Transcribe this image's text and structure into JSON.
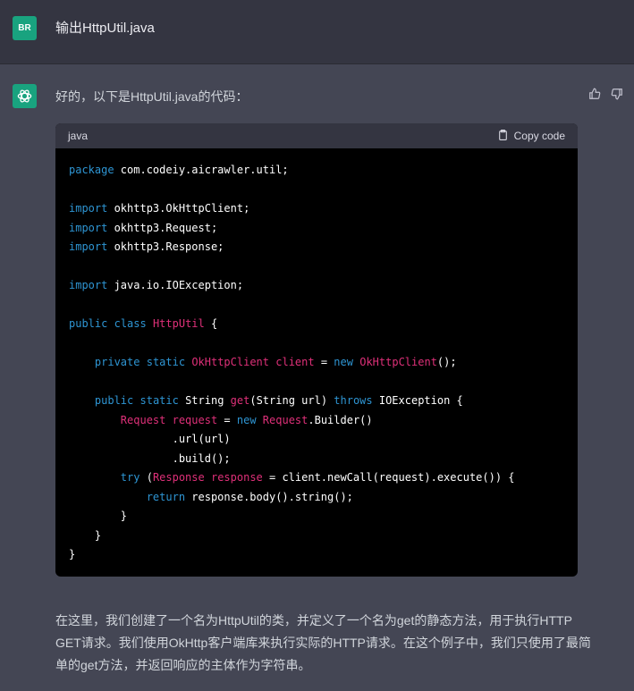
{
  "user": {
    "avatar_initials": "BR",
    "message": "输出HttpUtil.java"
  },
  "assistant": {
    "intro": "好的，以下是HttpUtil.java的代码：",
    "code_block": {
      "language": "java",
      "copy_label": "Copy code",
      "lines": [
        [
          {
            "t": "package",
            "c": "kw"
          },
          {
            "t": " com.codeiy.aicrawler.util;",
            "c": "pl"
          }
        ],
        [],
        [
          {
            "t": "import",
            "c": "kw"
          },
          {
            "t": " okhttp3.OkHttpClient;",
            "c": "pl"
          }
        ],
        [
          {
            "t": "import",
            "c": "kw"
          },
          {
            "t": " okhttp3.Request;",
            "c": "pl"
          }
        ],
        [
          {
            "t": "import",
            "c": "kw"
          },
          {
            "t": " okhttp3.Response;",
            "c": "pl"
          }
        ],
        [],
        [
          {
            "t": "import",
            "c": "kw"
          },
          {
            "t": " java.io.IOException;",
            "c": "pl"
          }
        ],
        [],
        [
          {
            "t": "public",
            "c": "kw"
          },
          {
            "t": " ",
            "c": "pl"
          },
          {
            "t": "class",
            "c": "kw"
          },
          {
            "t": " ",
            "c": "pl"
          },
          {
            "t": "HttpUtil",
            "c": "ty"
          },
          {
            "t": " {",
            "c": "pl"
          }
        ],
        [],
        [
          {
            "t": "    ",
            "c": "pl"
          },
          {
            "t": "private",
            "c": "kw"
          },
          {
            "t": " ",
            "c": "pl"
          },
          {
            "t": "static",
            "c": "kw"
          },
          {
            "t": " ",
            "c": "pl"
          },
          {
            "t": "OkHttpClient",
            "c": "ty"
          },
          {
            "t": " ",
            "c": "pl"
          },
          {
            "t": "client",
            "c": "ty"
          },
          {
            "t": " = ",
            "c": "pl"
          },
          {
            "t": "new",
            "c": "kw"
          },
          {
            "t": " ",
            "c": "pl"
          },
          {
            "t": "OkHttpClient",
            "c": "ty"
          },
          {
            "t": "();",
            "c": "pl"
          }
        ],
        [],
        [
          {
            "t": "    ",
            "c": "pl"
          },
          {
            "t": "public",
            "c": "kw"
          },
          {
            "t": " ",
            "c": "pl"
          },
          {
            "t": "static",
            "c": "kw"
          },
          {
            "t": " String ",
            "c": "pl"
          },
          {
            "t": "get",
            "c": "ty"
          },
          {
            "t": "(String url) ",
            "c": "pl"
          },
          {
            "t": "throws",
            "c": "kw"
          },
          {
            "t": " IOException {",
            "c": "pl"
          }
        ],
        [
          {
            "t": "        ",
            "c": "pl"
          },
          {
            "t": "Request",
            "c": "ty"
          },
          {
            "t": " ",
            "c": "pl"
          },
          {
            "t": "request",
            "c": "ty"
          },
          {
            "t": " = ",
            "c": "pl"
          },
          {
            "t": "new",
            "c": "kw"
          },
          {
            "t": " ",
            "c": "pl"
          },
          {
            "t": "Request",
            "c": "ty"
          },
          {
            "t": ".Builder()",
            "c": "pl"
          }
        ],
        [
          {
            "t": "                .url(url)",
            "c": "pl"
          }
        ],
        [
          {
            "t": "                .build();",
            "c": "pl"
          }
        ],
        [
          {
            "t": "        ",
            "c": "pl"
          },
          {
            "t": "try",
            "c": "kw"
          },
          {
            "t": " (",
            "c": "pl"
          },
          {
            "t": "Response",
            "c": "ty"
          },
          {
            "t": " ",
            "c": "pl"
          },
          {
            "t": "response",
            "c": "ty"
          },
          {
            "t": " = client.newCall(request).execute()) {",
            "c": "pl"
          }
        ],
        [
          {
            "t": "            ",
            "c": "pl"
          },
          {
            "t": "return",
            "c": "kw"
          },
          {
            "t": " response.body().string();",
            "c": "pl"
          }
        ],
        [
          {
            "t": "        }",
            "c": "pl"
          }
        ],
        [
          {
            "t": "    }",
            "c": "pl"
          }
        ],
        [
          {
            "t": "}",
            "c": "pl"
          }
        ]
      ]
    },
    "explanation": "在这里，我们创建了一个名为HttpUtil的类，并定义了一个名为get的静态方法，用于执行HTTP GET请求。我们使用OkHttp客户端库来执行实际的HTTP请求。在这个例子中，我们只使用了最简单的get方法，并返回响应的主体作为字符串。"
  },
  "colors": {
    "keyword": "#2e95d3",
    "type_identifier": "#df3079",
    "plain": "#ffffff",
    "avatar_green": "#19a37f"
  },
  "icons": [
    "chatgpt-logo-icon",
    "thumbs-up-icon",
    "thumbs-down-icon",
    "clipboard-icon"
  ]
}
